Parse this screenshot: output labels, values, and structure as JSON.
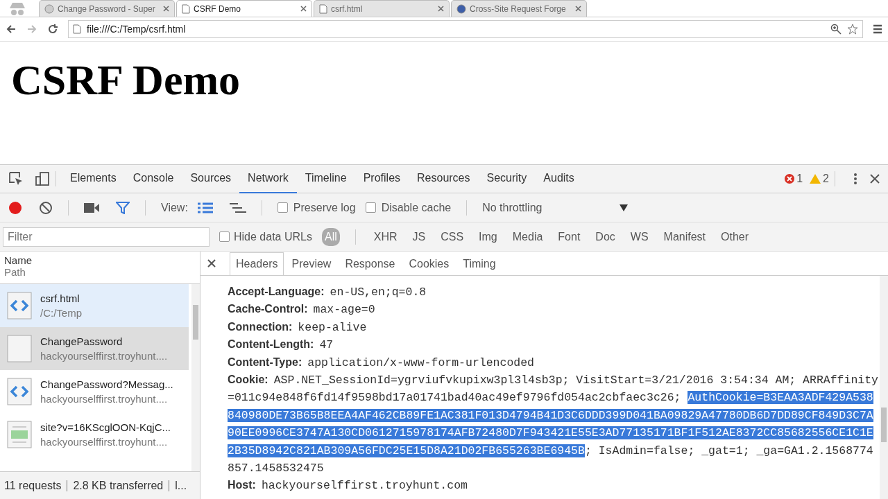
{
  "browser_tabs": [
    {
      "title": "Change Password - Super",
      "kind": "globe",
      "selected": false
    },
    {
      "title": "CSRF Demo",
      "kind": "page",
      "selected": true
    },
    {
      "title": "csrf.html",
      "kind": "page",
      "selected": false
    },
    {
      "title": "Cross-Site Request Forge",
      "kind": "site",
      "selected": false
    }
  ],
  "address_bar": {
    "url": "file:///C:/Temp/csrf.html"
  },
  "page": {
    "heading": "CSRF Demo"
  },
  "devtools": {
    "tabs": [
      {
        "label": "Elements",
        "selected": false
      },
      {
        "label": "Console",
        "selected": false
      },
      {
        "label": "Sources",
        "selected": false
      },
      {
        "label": "Network",
        "selected": true
      },
      {
        "label": "Timeline",
        "selected": false
      },
      {
        "label": "Profiles",
        "selected": false
      },
      {
        "label": "Resources",
        "selected": false
      },
      {
        "label": "Security",
        "selected": false
      },
      {
        "label": "Audits",
        "selected": false
      }
    ],
    "error_count": "1",
    "warning_count": "2",
    "toolbar": {
      "recording": true,
      "view_label": "View:",
      "preserve_log": {
        "label": "Preserve log",
        "checked": false
      },
      "disable_cache": {
        "label": "Disable cache",
        "checked": false
      },
      "throttling": "No throttling"
    },
    "filter_bar": {
      "placeholder": "Filter",
      "hide_data_urls": {
        "label": "Hide data URLs",
        "checked": false
      },
      "types": [
        {
          "label": "All",
          "selected": true
        },
        {
          "label": "XHR",
          "selected": false
        },
        {
          "label": "JS",
          "selected": false
        },
        {
          "label": "CSS",
          "selected": false
        },
        {
          "label": "Img",
          "selected": false
        },
        {
          "label": "Media",
          "selected": false
        },
        {
          "label": "Font",
          "selected": false
        },
        {
          "label": "Doc",
          "selected": false
        },
        {
          "label": "WS",
          "selected": false
        },
        {
          "label": "Manifest",
          "selected": false
        },
        {
          "label": "Other",
          "selected": false
        }
      ]
    },
    "requests": {
      "column_name": "Name",
      "column_path": "Path",
      "rows": [
        {
          "name": "csrf.html",
          "path": "/C:/Temp",
          "kind": "html",
          "selected": true,
          "hovered": false
        },
        {
          "name": "ChangePassword",
          "path": "hackyourselffirst.troyhunt....",
          "kind": "blank",
          "selected": false,
          "hovered": true
        },
        {
          "name": "ChangePassword?Messag...",
          "path": "hackyourselffirst.troyhunt....",
          "kind": "html",
          "selected": false,
          "hovered": false
        },
        {
          "name": "site?v=16KScglOON-KqjC...",
          "path": "hackyourselffirst.troyhunt....",
          "kind": "css",
          "selected": false,
          "hovered": false
        }
      ],
      "summary": "11 requests",
      "transferred": "2.8 KB transferred",
      "summary_more": "l..."
    },
    "detail_tabs": [
      {
        "label": "Headers",
        "selected": true
      },
      {
        "label": "Preview",
        "selected": false
      },
      {
        "label": "Response",
        "selected": false
      },
      {
        "label": "Cookies",
        "selected": false
      },
      {
        "label": "Timing",
        "selected": false
      }
    ],
    "headers": [
      {
        "name": "Accept-Language:",
        "parts": [
          {
            "text": "en-US,en;q=0.8",
            "selected": false
          }
        ]
      },
      {
        "name": "Cache-Control:",
        "parts": [
          {
            "text": "max-age=0",
            "selected": false
          }
        ]
      },
      {
        "name": "Connection:",
        "parts": [
          {
            "text": "keep-alive",
            "selected": false
          }
        ]
      },
      {
        "name": "Content-Length:",
        "parts": [
          {
            "text": "47",
            "selected": false
          }
        ]
      },
      {
        "name": "Content-Type:",
        "parts": [
          {
            "text": "application/x-www-form-urlencoded",
            "selected": false
          }
        ]
      },
      {
        "name": "Cookie:",
        "parts": [
          {
            "text": "ASP.NET_SessionId=ygrviufvkupixw3pl3l4sb3p; VisitStart=3/21/2016 3:54:34 AM; ARRAffinity=011c94e848f6fd14f9598bd17a01741bad40ac49ef9796fd054ac2cbfaec3c26; ",
            "selected": false
          },
          {
            "text": "AuthCookie=B3EAA3ADF429A538840980DE73B65B8EEA4AF462CB89FE1AC381F013D4794B41D3C6DDD399D041BA09829A47780DB6D7DD89CF849D3C7A90EE0996CE3747A130CD0612715978174AFB72480D7F943421E55E3AD77135171BF1F512AE8372CC85682556CE1C1E2B35D8942C821AB309A56FDC25E15D8A21D02FB655263BE6945B",
            "selected": true
          },
          {
            "text": "; IsAdmin=false; _gat=1; _ga=GA1.2.1568774857.1458532475",
            "selected": false
          }
        ]
      },
      {
        "name": "Host:",
        "parts": [
          {
            "text": "hackyourselffirst.troyhunt.com",
            "selected": false
          }
        ]
      }
    ]
  }
}
